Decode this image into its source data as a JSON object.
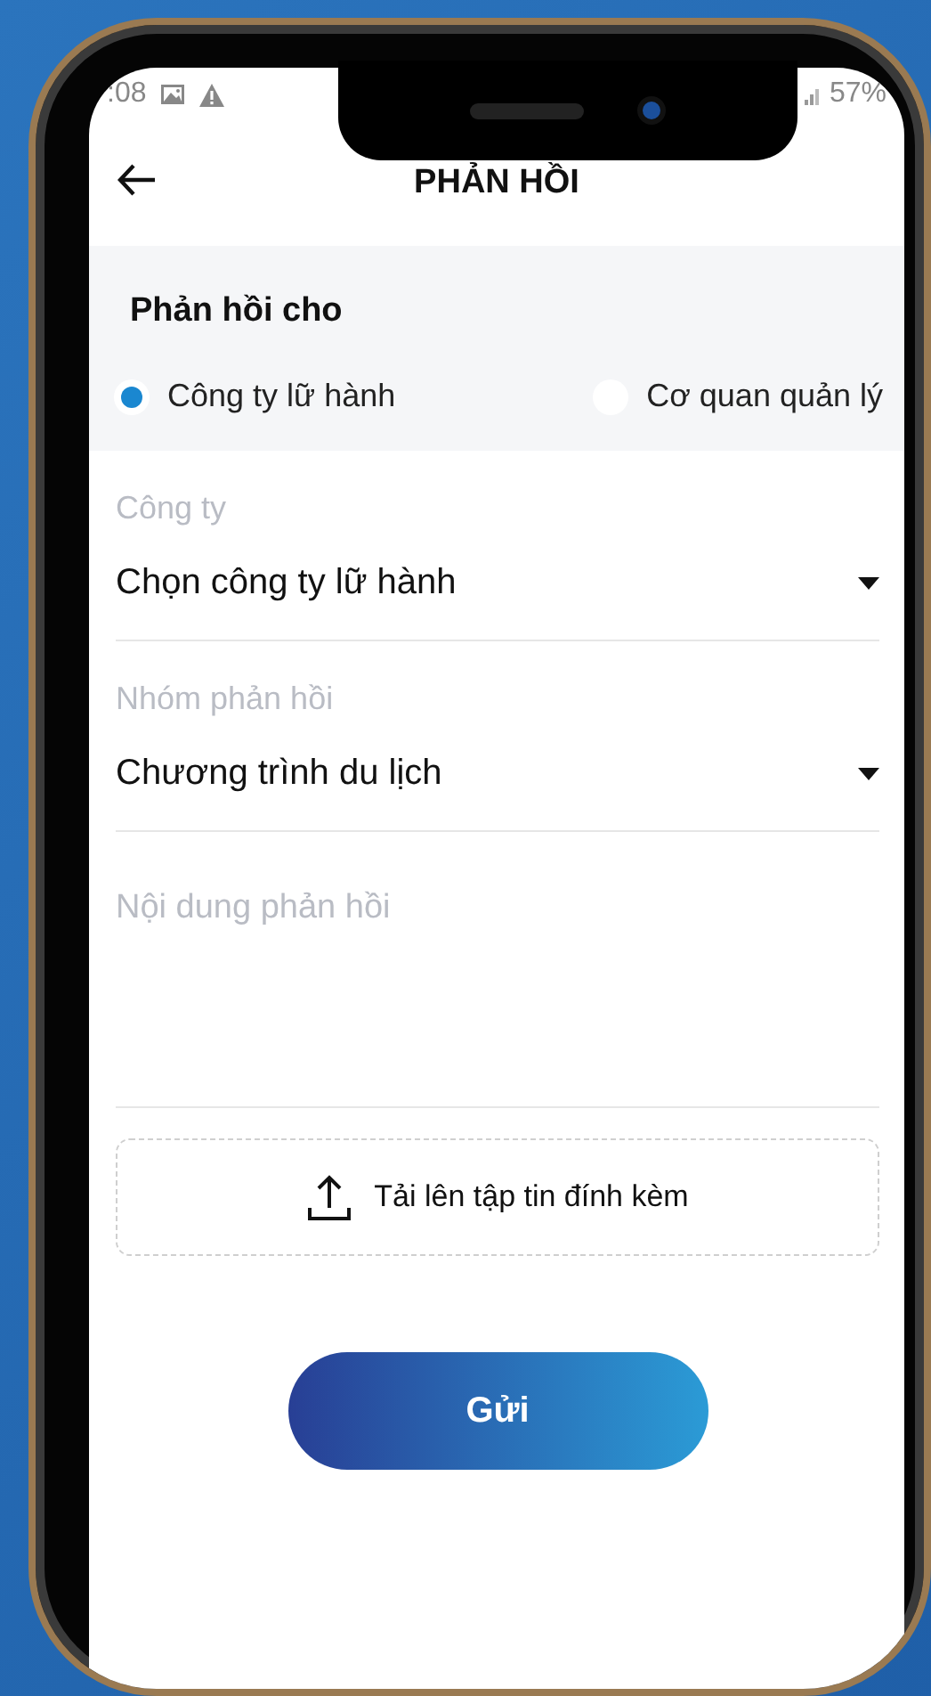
{
  "status_bar": {
    "time": ":08",
    "battery": "57%"
  },
  "header": {
    "title": "PHẢN HỒI"
  },
  "recipient": {
    "title": "Phản hồi cho",
    "options": [
      {
        "label": "Công ty lữ hành",
        "selected": true
      },
      {
        "label": "Cơ quan quản lý",
        "selected": false
      }
    ]
  },
  "fields": [
    {
      "kind": "dropdown",
      "label": "Công ty",
      "value": "Chọn công ty lữ hành"
    },
    {
      "kind": "dropdown",
      "label": "Nhóm phản hồi",
      "value": "Chương trình du lịch"
    },
    {
      "kind": "textarea",
      "placeholder": "Nội dung phản hồi"
    }
  ],
  "upload": {
    "label": "Tải lên tập tin đính kèm"
  },
  "submit": {
    "label": "Gửi"
  }
}
